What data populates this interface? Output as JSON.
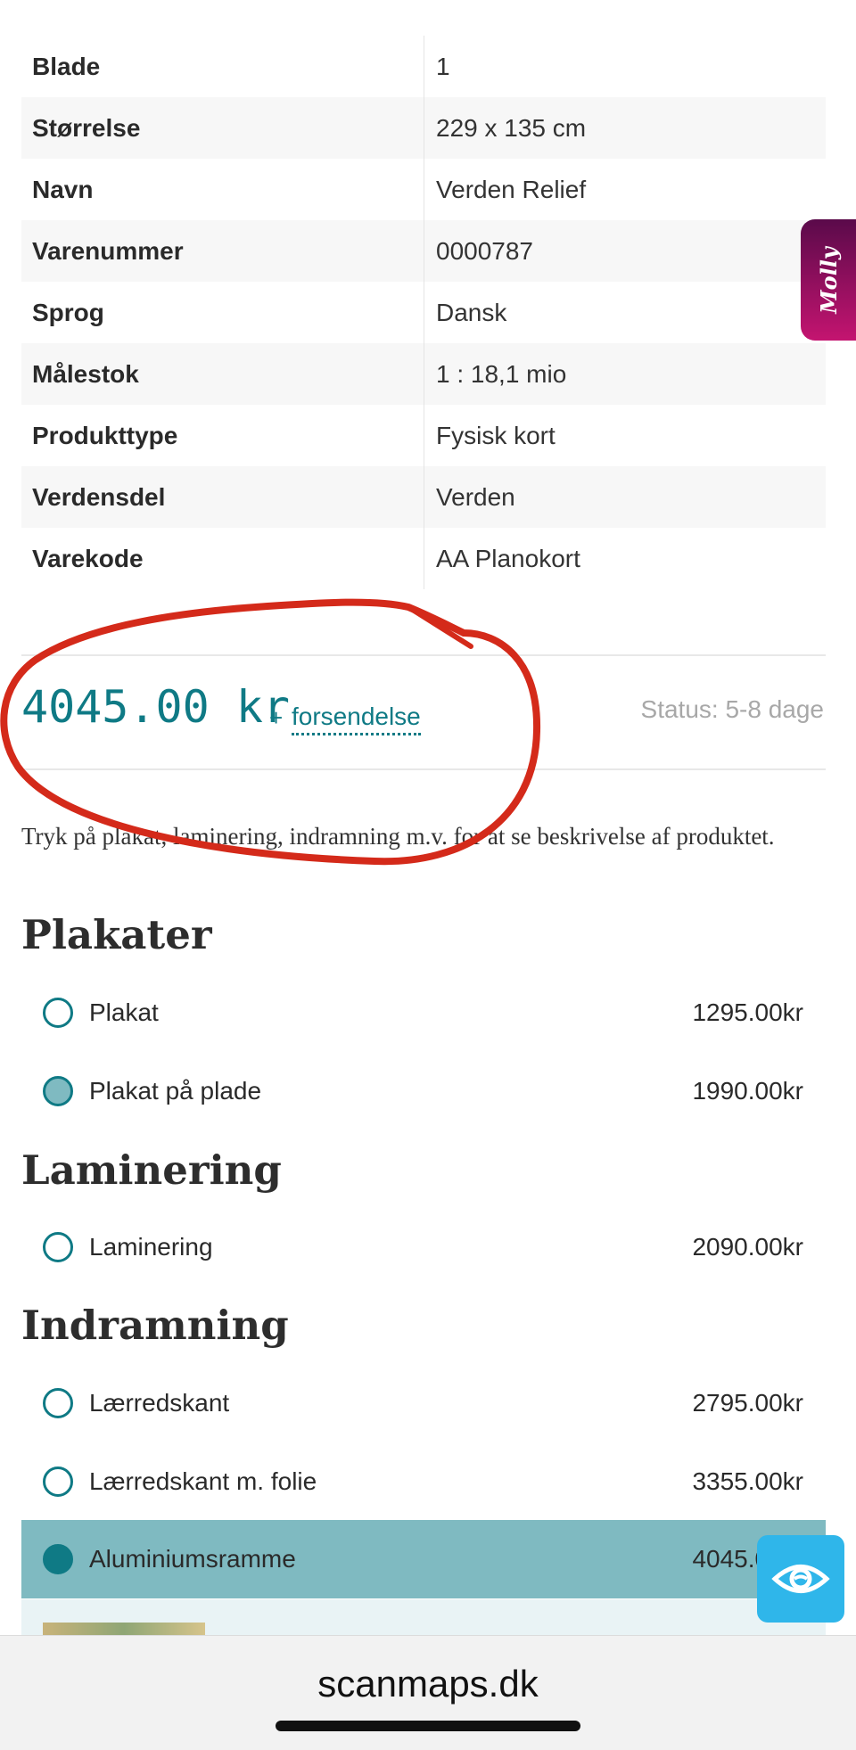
{
  "specs": [
    {
      "key": "Blade",
      "value": "1"
    },
    {
      "key": "Størrelse",
      "value": "229 x 135 cm"
    },
    {
      "key": "Navn",
      "value": "Verden Relief"
    },
    {
      "key": "Varenummer",
      "value": "0000787"
    },
    {
      "key": "Sprog",
      "value": "Dansk"
    },
    {
      "key": "Målestok",
      "value": "1 : 18,1 mio"
    },
    {
      "key": "Produkttype",
      "value": "Fysisk kort"
    },
    {
      "key": "Verdensdel",
      "value": "Verden"
    },
    {
      "key": "Varekode",
      "value": "AA Planokort"
    }
  ],
  "price": {
    "amount": "4045.00 kr",
    "plus": "+",
    "shipping_link": "forsendelse",
    "status": "Status: 5-8 dage"
  },
  "intro_text": "Tryk på plakat, laminering, indramning m.v. for at se beskrivelse af produktet.",
  "sections": {
    "plakater": {
      "title": "Plakater",
      "options": [
        {
          "label": "Plakat",
          "price": "1295.00kr"
        },
        {
          "label": "Plakat på plade",
          "price": "1990.00kr"
        }
      ]
    },
    "laminering": {
      "title": "Laminering",
      "options": [
        {
          "label": "Laminering",
          "price": "2090.00kr"
        }
      ]
    },
    "indramning": {
      "title": "Indramning",
      "options": [
        {
          "label": "Lærredskant",
          "price": "2795.00kr"
        },
        {
          "label": "Lærredskant m. folie",
          "price": "3355.00kr"
        },
        {
          "label": "Aluminiumsramme",
          "price": "4045.00kr"
        }
      ]
    }
  },
  "selected_option": "Aluminiumsramme",
  "widgets": {
    "molly_label": "Molly",
    "accessibility_icon": "eye-icon"
  },
  "browser": {
    "url": "scanmaps.dk"
  },
  "colors": {
    "accent": "#0f7a85",
    "selected_bg": "#7fbac1",
    "annotation": "#d42a1a",
    "molly_gradient_start": "#5a0a4a",
    "molly_gradient_end": "#c41470",
    "a11y_bg": "#2fb6ea"
  }
}
